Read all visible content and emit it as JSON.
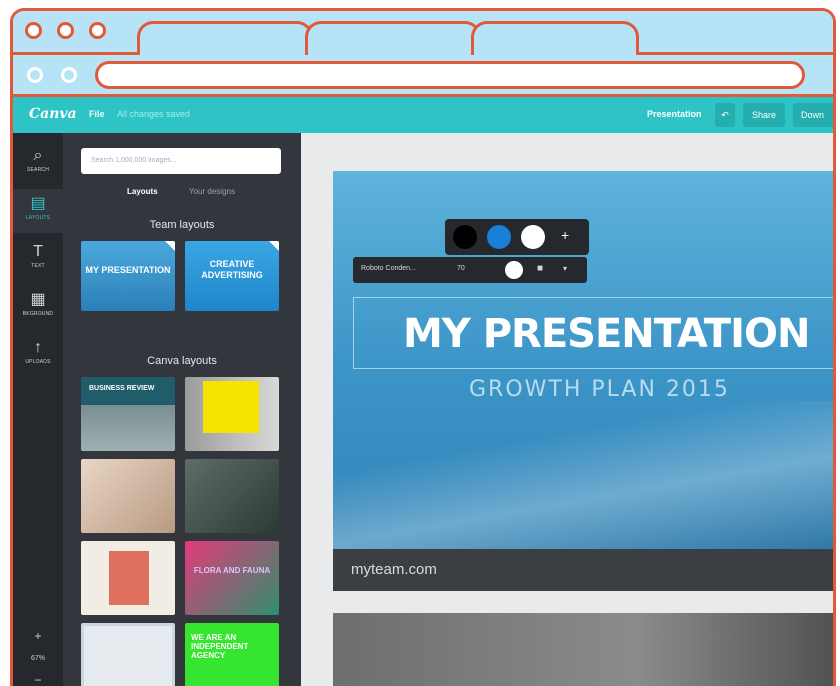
{
  "app": {
    "logo": "Canva",
    "menu_file": "File",
    "save_status": "All changes saved",
    "presentation_name": "Presentation",
    "undo_icon": "undo-icon",
    "share_label": "Share",
    "download_label": "Down"
  },
  "rail": {
    "items": [
      {
        "label": "SEARCH",
        "icon": "⌕"
      },
      {
        "label": "LAYOUTS",
        "icon": "▤"
      },
      {
        "label": "TEXT",
        "icon": "T"
      },
      {
        "label": "BKGROUND",
        "icon": "▦"
      },
      {
        "label": "UPLOADS",
        "icon": "↑"
      }
    ],
    "zoom_in": "+",
    "zoom_value": "67%",
    "zoom_out": "−"
  },
  "panel": {
    "search_placeholder": "Search 1,000,000 images...",
    "tab_layouts": "Layouts",
    "tab_designs": "Your designs",
    "team_title": "Team layouts",
    "canva_title": "Canva layouts",
    "team_thumbs": [
      "MY PRESENTATION",
      "CREATIVE ADVERTISING"
    ],
    "canva_thumbs": [
      "BUSINESS REVIEW",
      "",
      "",
      "",
      "",
      "FLORA AND FAUNA",
      "",
      "WE ARE AN INDEPENDENT AGENCY"
    ]
  },
  "slide": {
    "title": "MY PRESENTATION",
    "subtitle": "GROWTH PLAN 2015",
    "footer": "myteam.com"
  },
  "toolbar": {
    "font": "Roboto Conden...",
    "size": "70",
    "add": "+",
    "more": "▾",
    "trash": "■"
  },
  "colors": {
    "accent": "#2ec4c6",
    "swatches": [
      "#000000",
      "#1a7fd6",
      "#ffffff"
    ]
  }
}
